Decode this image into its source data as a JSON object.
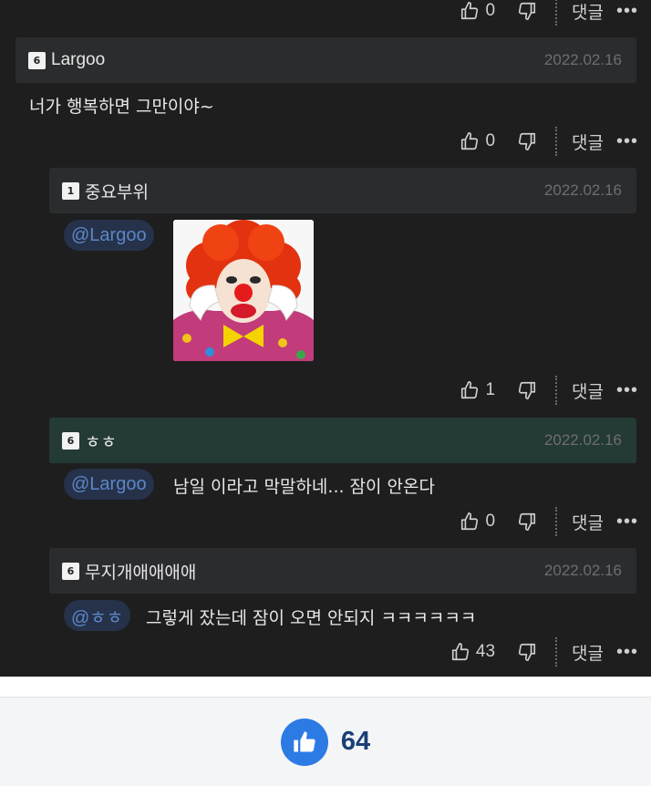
{
  "comments": [
    {
      "level": "6",
      "nickname": "Largoo",
      "date": "2022.02.16",
      "text": "너가 행복하면 그만이야~",
      "likes": "0",
      "reply_label": "댓글"
    },
    {
      "level": "1",
      "nickname": "중요부위",
      "date": "2022.02.16",
      "mention": "@Largoo",
      "image_alt": "clown",
      "likes": "1",
      "reply_label": "댓글"
    },
    {
      "level": "6",
      "nickname": "ㅎㅎ",
      "date": "2022.02.16",
      "mention": "@Largoo",
      "text": "남일 이라고 막말하네... 잠이 안온다",
      "likes": "0",
      "reply_label": "댓글"
    },
    {
      "level": "6",
      "nickname": "무지개애애애애",
      "date": "2022.02.16",
      "mention": "@ㅎㅎ",
      "text": "그렇게 잤는데 잠이 오면 안되지 ㅋㅋㅋㅋㅋㅋ",
      "likes": "43",
      "reply_label": "댓글"
    }
  ],
  "top_partial": {
    "likes": "0",
    "reply_label": "댓글"
  },
  "footer": {
    "like_count": "64"
  },
  "colors": {
    "background": "#1e1e1f",
    "header": "#2b2c2e",
    "highlight_header": "#243a34",
    "mention_text": "#5d86c8",
    "like_button": "#2c7be5"
  }
}
